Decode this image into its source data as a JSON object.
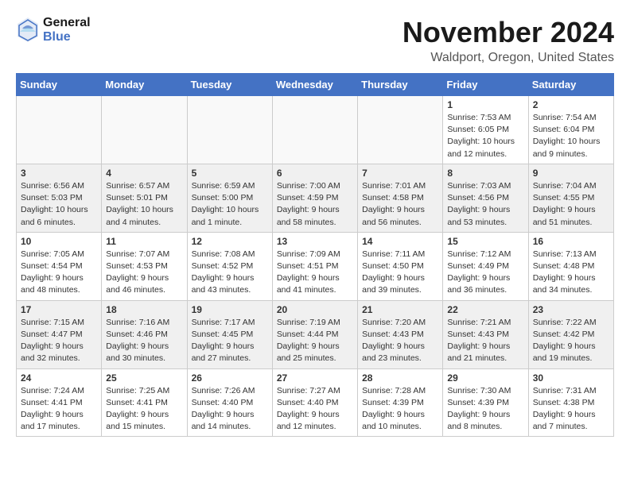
{
  "header": {
    "logo_general": "General",
    "logo_blue": "Blue",
    "month_title": "November 2024",
    "location": "Waldport, Oregon, United States"
  },
  "days_of_week": [
    "Sunday",
    "Monday",
    "Tuesday",
    "Wednesday",
    "Thursday",
    "Friday",
    "Saturday"
  ],
  "weeks": [
    [
      {
        "day": "",
        "info": ""
      },
      {
        "day": "",
        "info": ""
      },
      {
        "day": "",
        "info": ""
      },
      {
        "day": "",
        "info": ""
      },
      {
        "day": "",
        "info": ""
      },
      {
        "day": "1",
        "info": "Sunrise: 7:53 AM\nSunset: 6:05 PM\nDaylight: 10 hours and 12 minutes."
      },
      {
        "day": "2",
        "info": "Sunrise: 7:54 AM\nSunset: 6:04 PM\nDaylight: 10 hours and 9 minutes."
      }
    ],
    [
      {
        "day": "3",
        "info": "Sunrise: 6:56 AM\nSunset: 5:03 PM\nDaylight: 10 hours and 6 minutes."
      },
      {
        "day": "4",
        "info": "Sunrise: 6:57 AM\nSunset: 5:01 PM\nDaylight: 10 hours and 4 minutes."
      },
      {
        "day": "5",
        "info": "Sunrise: 6:59 AM\nSunset: 5:00 PM\nDaylight: 10 hours and 1 minute."
      },
      {
        "day": "6",
        "info": "Sunrise: 7:00 AM\nSunset: 4:59 PM\nDaylight: 9 hours and 58 minutes."
      },
      {
        "day": "7",
        "info": "Sunrise: 7:01 AM\nSunset: 4:58 PM\nDaylight: 9 hours and 56 minutes."
      },
      {
        "day": "8",
        "info": "Sunrise: 7:03 AM\nSunset: 4:56 PM\nDaylight: 9 hours and 53 minutes."
      },
      {
        "day": "9",
        "info": "Sunrise: 7:04 AM\nSunset: 4:55 PM\nDaylight: 9 hours and 51 minutes."
      }
    ],
    [
      {
        "day": "10",
        "info": "Sunrise: 7:05 AM\nSunset: 4:54 PM\nDaylight: 9 hours and 48 minutes."
      },
      {
        "day": "11",
        "info": "Sunrise: 7:07 AM\nSunset: 4:53 PM\nDaylight: 9 hours and 46 minutes."
      },
      {
        "day": "12",
        "info": "Sunrise: 7:08 AM\nSunset: 4:52 PM\nDaylight: 9 hours and 43 minutes."
      },
      {
        "day": "13",
        "info": "Sunrise: 7:09 AM\nSunset: 4:51 PM\nDaylight: 9 hours and 41 minutes."
      },
      {
        "day": "14",
        "info": "Sunrise: 7:11 AM\nSunset: 4:50 PM\nDaylight: 9 hours and 39 minutes."
      },
      {
        "day": "15",
        "info": "Sunrise: 7:12 AM\nSunset: 4:49 PM\nDaylight: 9 hours and 36 minutes."
      },
      {
        "day": "16",
        "info": "Sunrise: 7:13 AM\nSunset: 4:48 PM\nDaylight: 9 hours and 34 minutes."
      }
    ],
    [
      {
        "day": "17",
        "info": "Sunrise: 7:15 AM\nSunset: 4:47 PM\nDaylight: 9 hours and 32 minutes."
      },
      {
        "day": "18",
        "info": "Sunrise: 7:16 AM\nSunset: 4:46 PM\nDaylight: 9 hours and 30 minutes."
      },
      {
        "day": "19",
        "info": "Sunrise: 7:17 AM\nSunset: 4:45 PM\nDaylight: 9 hours and 27 minutes."
      },
      {
        "day": "20",
        "info": "Sunrise: 7:19 AM\nSunset: 4:44 PM\nDaylight: 9 hours and 25 minutes."
      },
      {
        "day": "21",
        "info": "Sunrise: 7:20 AM\nSunset: 4:43 PM\nDaylight: 9 hours and 23 minutes."
      },
      {
        "day": "22",
        "info": "Sunrise: 7:21 AM\nSunset: 4:43 PM\nDaylight: 9 hours and 21 minutes."
      },
      {
        "day": "23",
        "info": "Sunrise: 7:22 AM\nSunset: 4:42 PM\nDaylight: 9 hours and 19 minutes."
      }
    ],
    [
      {
        "day": "24",
        "info": "Sunrise: 7:24 AM\nSunset: 4:41 PM\nDaylight: 9 hours and 17 minutes."
      },
      {
        "day": "25",
        "info": "Sunrise: 7:25 AM\nSunset: 4:41 PM\nDaylight: 9 hours and 15 minutes."
      },
      {
        "day": "26",
        "info": "Sunrise: 7:26 AM\nSunset: 4:40 PM\nDaylight: 9 hours and 14 minutes."
      },
      {
        "day": "27",
        "info": "Sunrise: 7:27 AM\nSunset: 4:40 PM\nDaylight: 9 hours and 12 minutes."
      },
      {
        "day": "28",
        "info": "Sunrise: 7:28 AM\nSunset: 4:39 PM\nDaylight: 9 hours and 10 minutes."
      },
      {
        "day": "29",
        "info": "Sunrise: 7:30 AM\nSunset: 4:39 PM\nDaylight: 9 hours and 8 minutes."
      },
      {
        "day": "30",
        "info": "Sunrise: 7:31 AM\nSunset: 4:38 PM\nDaylight: 9 hours and 7 minutes."
      }
    ]
  ]
}
